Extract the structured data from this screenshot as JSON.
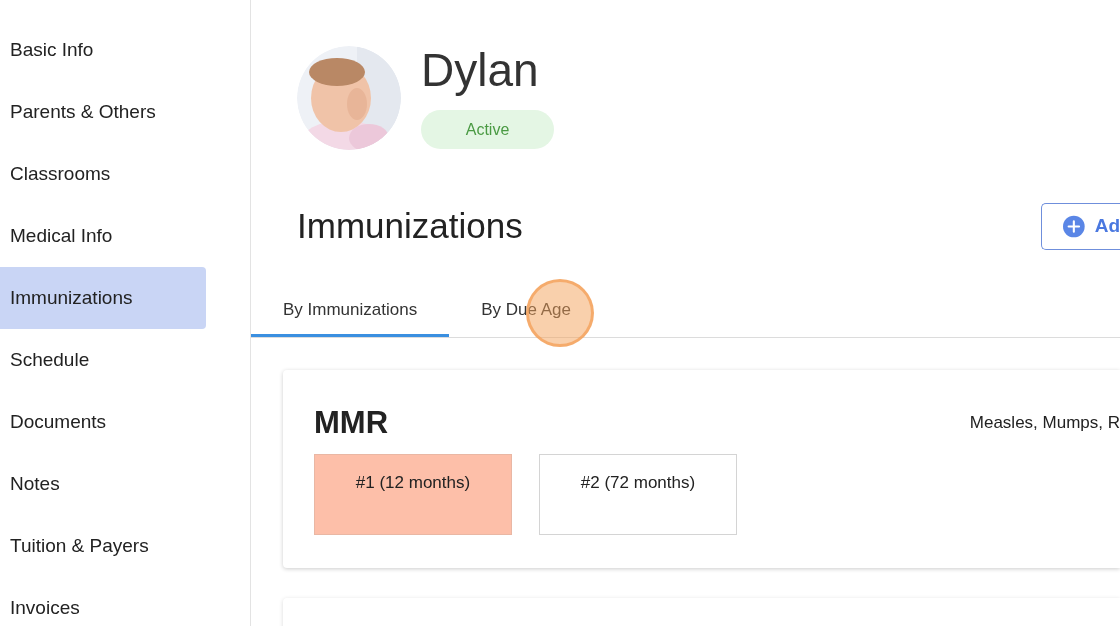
{
  "sidebar": {
    "items": [
      {
        "label": "Basic Info",
        "selected": false
      },
      {
        "label": "Parents & Others",
        "selected": false
      },
      {
        "label": "Classrooms",
        "selected": false
      },
      {
        "label": "Medical Info",
        "selected": false
      },
      {
        "label": "Immunizations",
        "selected": true
      },
      {
        "label": "Schedule",
        "selected": false
      },
      {
        "label": "Documents",
        "selected": false
      },
      {
        "label": "Notes",
        "selected": false
      },
      {
        "label": "Tuition & Payers",
        "selected": false
      },
      {
        "label": "Invoices",
        "selected": false
      }
    ]
  },
  "profile": {
    "name": "Dylan",
    "status": "Active"
  },
  "section": {
    "title": "Immunizations",
    "add_button": "Ad"
  },
  "tabs": [
    {
      "label": "By Immunizations",
      "selected": true
    },
    {
      "label": "By Due Age",
      "selected": false
    }
  ],
  "click_indicator": {
    "on": true
  },
  "cards": [
    {
      "title": "MMR",
      "description": "Measles, Mumps, R",
      "doses": [
        {
          "label": "#1 (12 months)",
          "overdue": true
        },
        {
          "label": "#2 (72 months)",
          "overdue": false
        }
      ]
    }
  ]
}
